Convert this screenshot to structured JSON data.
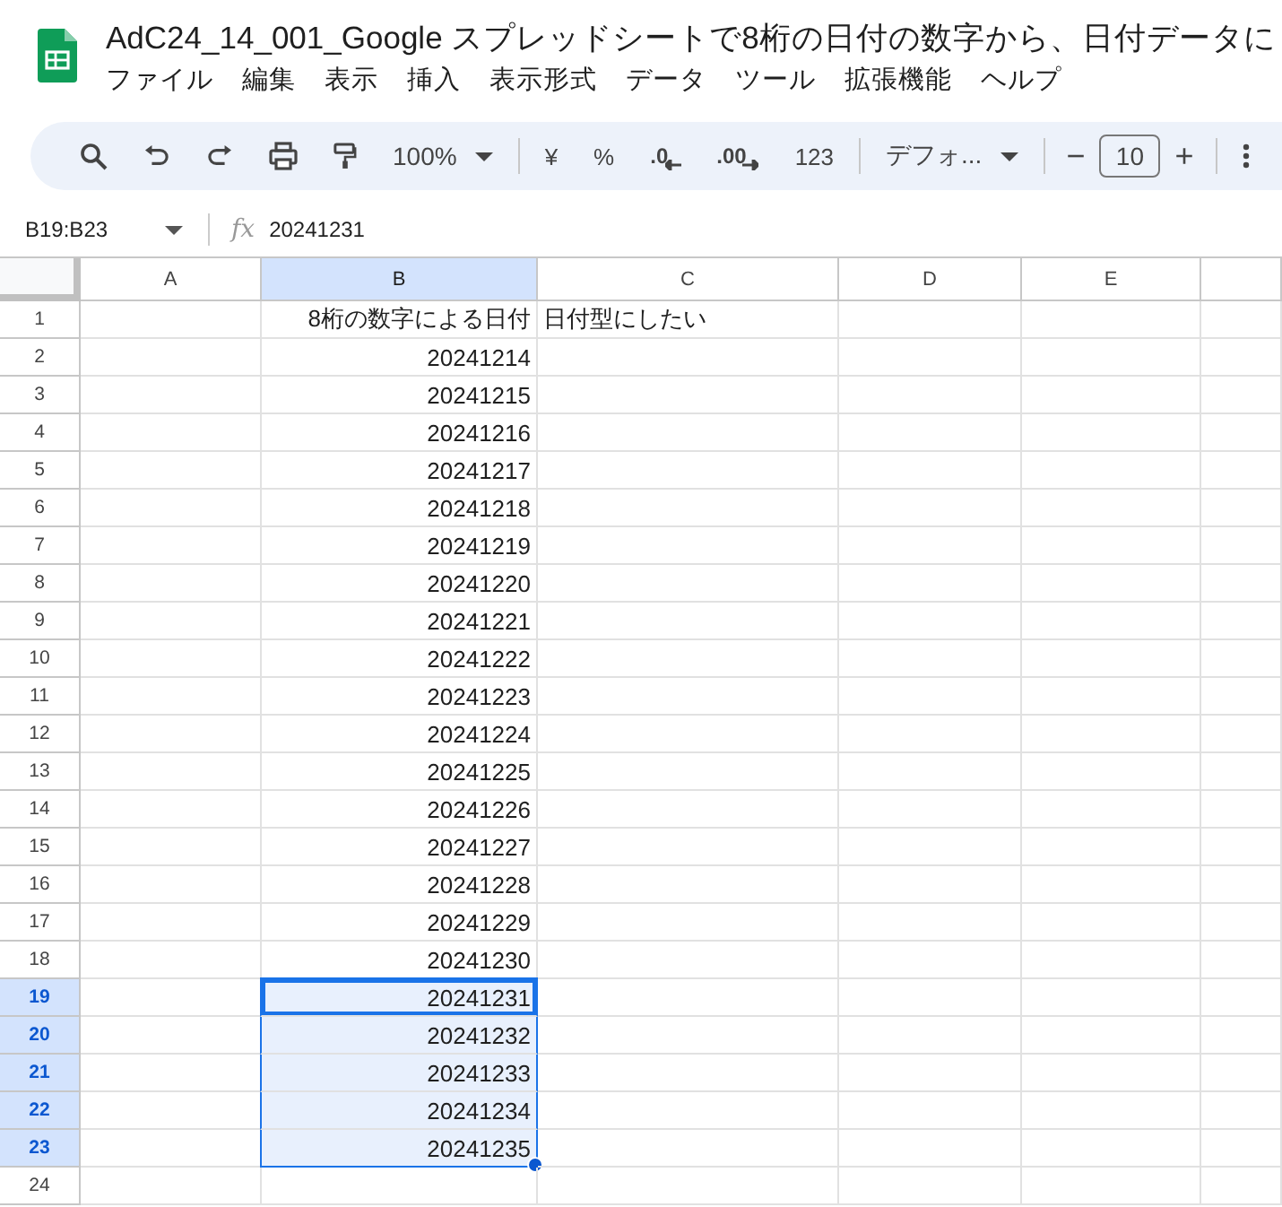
{
  "document": {
    "title": "AdC24_14_001_Google スプレッドシートで8桁の日付の数字から、日付データに"
  },
  "menu": [
    "ファイル",
    "編集",
    "表示",
    "挿入",
    "表示形式",
    "データ",
    "ツール",
    "拡張機能",
    "ヘルプ"
  ],
  "toolbar": [
    {
      "kind": "search"
    },
    {
      "kind": "undo"
    },
    {
      "kind": "redo"
    },
    {
      "kind": "print"
    },
    {
      "kind": "paint"
    },
    {
      "kind": "dropdown",
      "label": "100%"
    },
    {
      "kind": "sep"
    },
    {
      "kind": "text",
      "label": "¥"
    },
    {
      "kind": "text",
      "label": "%"
    },
    {
      "kind": "dec-left",
      "label": ".0"
    },
    {
      "kind": "dec-right",
      "label": ".00"
    },
    {
      "kind": "text",
      "label": "123"
    },
    {
      "kind": "sep"
    },
    {
      "kind": "dropdown",
      "label": "デフォ..."
    },
    {
      "kind": "sep"
    },
    {
      "kind": "minus",
      "label": "−"
    },
    {
      "kind": "size",
      "label": "10"
    },
    {
      "kind": "plus",
      "label": "+"
    },
    {
      "kind": "sep"
    },
    {
      "kind": "more"
    }
  ],
  "formula_bar": {
    "name_box": "B19:B23",
    "fx": "fx",
    "content": "20241231"
  },
  "columns": [
    {
      "label": "A",
      "selected": false
    },
    {
      "label": "B",
      "selected": true
    },
    {
      "label": "C",
      "selected": false
    },
    {
      "label": "D",
      "selected": false
    },
    {
      "label": "E",
      "selected": false
    }
  ],
  "rows": [
    {
      "number": "1",
      "b": "8桁の数字による日付",
      "c": "日付型にしたい",
      "selected": false,
      "active": false
    },
    {
      "number": "2",
      "b": "20241214",
      "selected": false,
      "active": false
    },
    {
      "number": "3",
      "b": "20241215",
      "selected": false,
      "active": false
    },
    {
      "number": "4",
      "b": "20241216",
      "selected": false,
      "active": false
    },
    {
      "number": "5",
      "b": "20241217",
      "selected": false,
      "active": false
    },
    {
      "number": "6",
      "b": "20241218",
      "selected": false,
      "active": false
    },
    {
      "number": "7",
      "b": "20241219",
      "selected": false,
      "active": false
    },
    {
      "number": "8",
      "b": "20241220",
      "selected": false,
      "active": false
    },
    {
      "number": "9",
      "b": "20241221",
      "selected": false,
      "active": false
    },
    {
      "number": "10",
      "b": "20241222",
      "selected": false,
      "active": false
    },
    {
      "number": "11",
      "b": "20241223",
      "selected": false,
      "active": false
    },
    {
      "number": "12",
      "b": "20241224",
      "selected": false,
      "active": false
    },
    {
      "number": "13",
      "b": "20241225",
      "selected": false,
      "active": false
    },
    {
      "number": "14",
      "b": "20241226",
      "selected": false,
      "active": false
    },
    {
      "number": "15",
      "b": "20241227",
      "selected": false,
      "active": false
    },
    {
      "number": "16",
      "b": "20241228",
      "selected": false,
      "active": false
    },
    {
      "number": "17",
      "b": "20241229",
      "selected": false,
      "active": false
    },
    {
      "number": "18",
      "b": "20241230",
      "selected": false,
      "active": false
    },
    {
      "number": "19",
      "b": "20241231",
      "selected": true,
      "active": true
    },
    {
      "number": "20",
      "b": "20241232",
      "selected": true,
      "active": false
    },
    {
      "number": "21",
      "b": "20241233",
      "selected": true,
      "active": false
    },
    {
      "number": "22",
      "b": "20241234",
      "selected": true,
      "active": false
    },
    {
      "number": "23",
      "b": "20241235",
      "selected": true,
      "active": false
    },
    {
      "number": "24",
      "selected": false,
      "active": false
    }
  ]
}
